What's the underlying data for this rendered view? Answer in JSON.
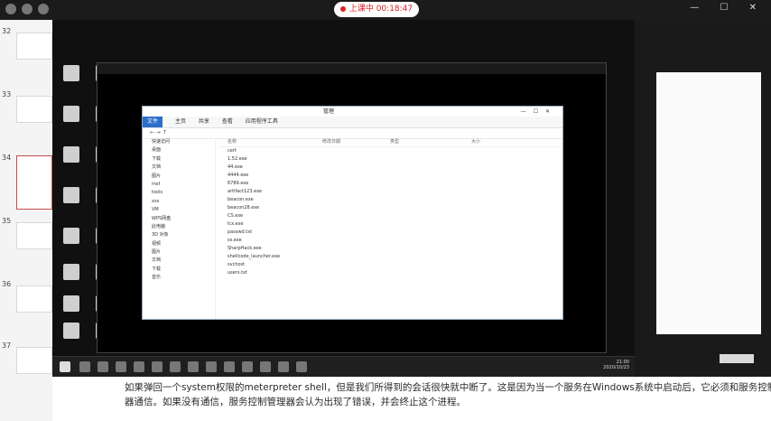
{
  "recording_bar": {
    "label": "上课中 00:18:47"
  },
  "slides": [
    {
      "num": "32"
    },
    {
      "num": "33"
    },
    {
      "num": "34"
    },
    {
      "num": "35"
    },
    {
      "num": "36"
    },
    {
      "num": "37"
    }
  ],
  "explorer": {
    "title": "管理",
    "ribbon_tabs": [
      "文件",
      "主页",
      "共享",
      "查看",
      "应用程序工具"
    ],
    "nav": [
      "快速访问",
      "桌面",
      "下载",
      "文档",
      "图片",
      "msf",
      "tools",
      "xss",
      "VM",
      "WPS网盘",
      "此电脑",
      "3D 对象",
      "视频",
      "图片",
      "文档",
      "下载",
      "音乐"
    ],
    "columns": [
      "名称",
      "修改日期",
      "类型",
      "大小"
    ],
    "files": [
      "cert",
      "1.52.exe",
      "44.exe",
      "4444.exe",
      "6789.exe",
      "artifact123.exe",
      "beacon.exe",
      "beacon28.exe",
      "CS.exe",
      "lcx.exe",
      "passwd.txt",
      "ss.exe",
      "SharpHack.exe",
      "shellcode_launcher.exe",
      "svchost",
      "users.txt"
    ]
  },
  "taskbar": {
    "time": "21:00",
    "date": "2020/10/23"
  },
  "subtitle": {
    "line1": "如果弹回一个system权限的meterpreter shell，但是我们所得到的会话很快就中断了。这是因为当一个服务在Windows系统中启动后，它必须和服务控制管理",
    "line2": "器通信。如果没有通信，服务控制管理器会认为出现了错误，并会终止这个进程。"
  }
}
